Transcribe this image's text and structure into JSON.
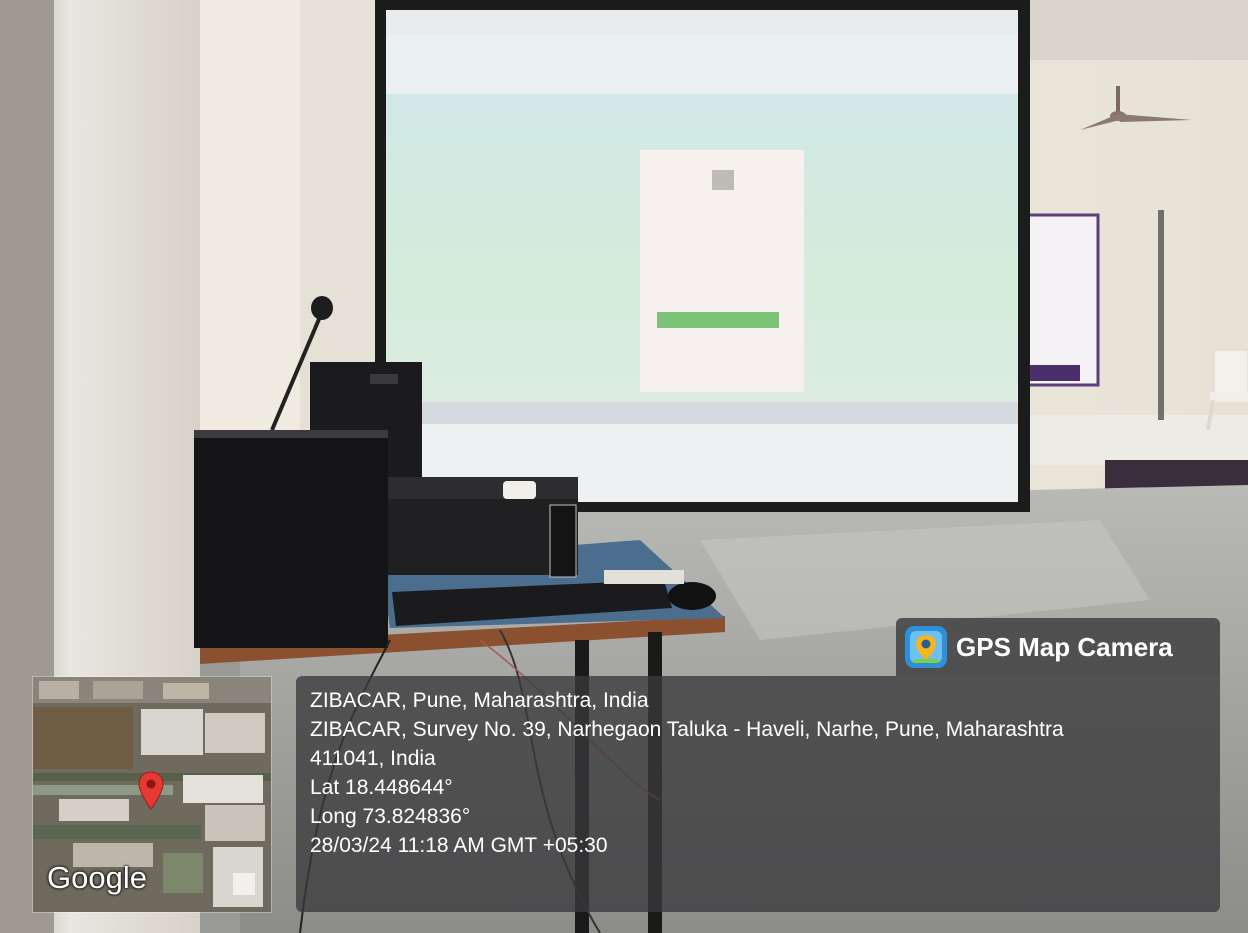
{
  "overlay": {
    "app_name": "GPS Map Camera",
    "map_brand": "Google",
    "location_title": "ZIBACAR, Pune, Maharashtra, India",
    "address_line1": "ZIBACAR, Survey No. 39, Narhegaon Taluka - Haveli, Narhe, Pune, Maharashtra",
    "address_line2": "411041, India",
    "latitude": "Lat 18.448644°",
    "longitude": "Long 73.824836°",
    "timestamp": "28/03/24 11:18 AM GMT +05:30"
  },
  "colors": {
    "panel_bg": "#3a3a3c",
    "pin": "#e53935",
    "text": "#ffffff",
    "screen": "#c7e2e8"
  },
  "icons": {
    "app_logo": "map-camera-logo-icon",
    "pin": "map-pin-icon"
  }
}
